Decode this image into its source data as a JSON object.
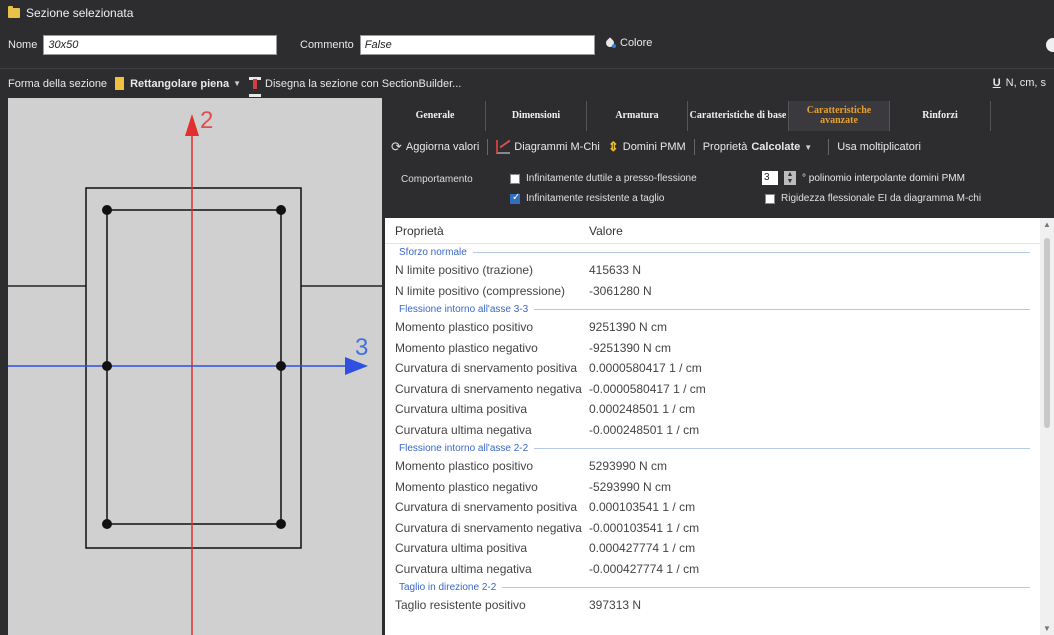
{
  "header": {
    "title": "Sezione selezionata",
    "name_label": "Nome",
    "name_value": "30x50",
    "comment_label": "Commento",
    "comment_value": "False",
    "color_label": "Colore"
  },
  "shape_bar": {
    "label": "Forma della sezione",
    "shape_value": "Rettangolare piena",
    "builder_label": "Disegna la sezione con SectionBuilder...",
    "units_icon_text": "U",
    "units_text": "N, cm, s"
  },
  "canvas": {
    "axis_vertical_label": "2",
    "axis_horizontal_label": "3"
  },
  "tabs": [
    {
      "label": "Generale",
      "active": false
    },
    {
      "label": "Dimensioni",
      "active": false
    },
    {
      "label": "Armatura",
      "active": false
    },
    {
      "label": "Caratteristiche di base",
      "active": false
    },
    {
      "label": "Caratteristiche avanzate",
      "active": true
    },
    {
      "label": "Rinforzi",
      "active": false
    }
  ],
  "actions": {
    "refresh": "Aggiorna valori",
    "diagrams": "Diagrammi M-Chi",
    "domains": "Domini PMM",
    "properties_label": "Proprietà",
    "properties_value": "Calcolate",
    "multipliers": "Usa moltiplicatori"
  },
  "options": {
    "behavior_label": "Comportamento",
    "ductile_label": "Infinitamente duttile a presso-flessione",
    "ductile_checked": false,
    "shear_label": "Infinitamente resistente a taglio",
    "shear_checked": true,
    "poly_value": "3",
    "poly_label": "° polinomio interpolante domini PMM",
    "stiffness_label": "Rigidezza flessionale EI da diagramma M-chi",
    "stiffness_checked": false
  },
  "grid": {
    "col_property": "Proprietà",
    "col_value": "Valore",
    "groups": [
      {
        "title": "Sforzo normale",
        "rows": [
          {
            "name": "N limite positivo (trazione)",
            "value": "415633 N"
          },
          {
            "name": "N limite positivo (compressione)",
            "value": "-3061280 N"
          }
        ]
      },
      {
        "title": "Flessione intorno all'asse 3-3",
        "rows": [
          {
            "name": "Momento plastico positivo",
            "value": "9251390 N cm"
          },
          {
            "name": "Momento plastico negativo",
            "value": "-9251390 N cm"
          },
          {
            "name": "Curvatura di snervamento positiva",
            "value": "0.0000580417 1 / cm"
          },
          {
            "name": "Curvatura di snervamento negativa",
            "value": "-0.0000580417 1 / cm"
          },
          {
            "name": "Curvatura ultima positiva",
            "value": "0.000248501 1 / cm"
          },
          {
            "name": "Curvatura ultima negativa",
            "value": "-0.000248501 1 / cm"
          }
        ]
      },
      {
        "title": "Flessione intorno all'asse 2-2",
        "rows": [
          {
            "name": "Momento plastico positivo",
            "value": "5293990 N cm"
          },
          {
            "name": "Momento plastico negativo",
            "value": "-5293990 N cm"
          },
          {
            "name": "Curvatura di snervamento positiva",
            "value": "0.000103541 1 / cm"
          },
          {
            "name": "Curvatura di snervamento negativa",
            "value": "-0.000103541 1 / cm"
          },
          {
            "name": "Curvatura ultima positiva",
            "value": "0.000427774 1 / cm"
          },
          {
            "name": "Curvatura ultima negativa",
            "value": "-0.000427774 1 / cm"
          }
        ]
      },
      {
        "title": "Taglio in direzione 2-2",
        "rows": [
          {
            "name": "Taglio resistente positivo",
            "value": "397313 N"
          }
        ]
      }
    ]
  }
}
